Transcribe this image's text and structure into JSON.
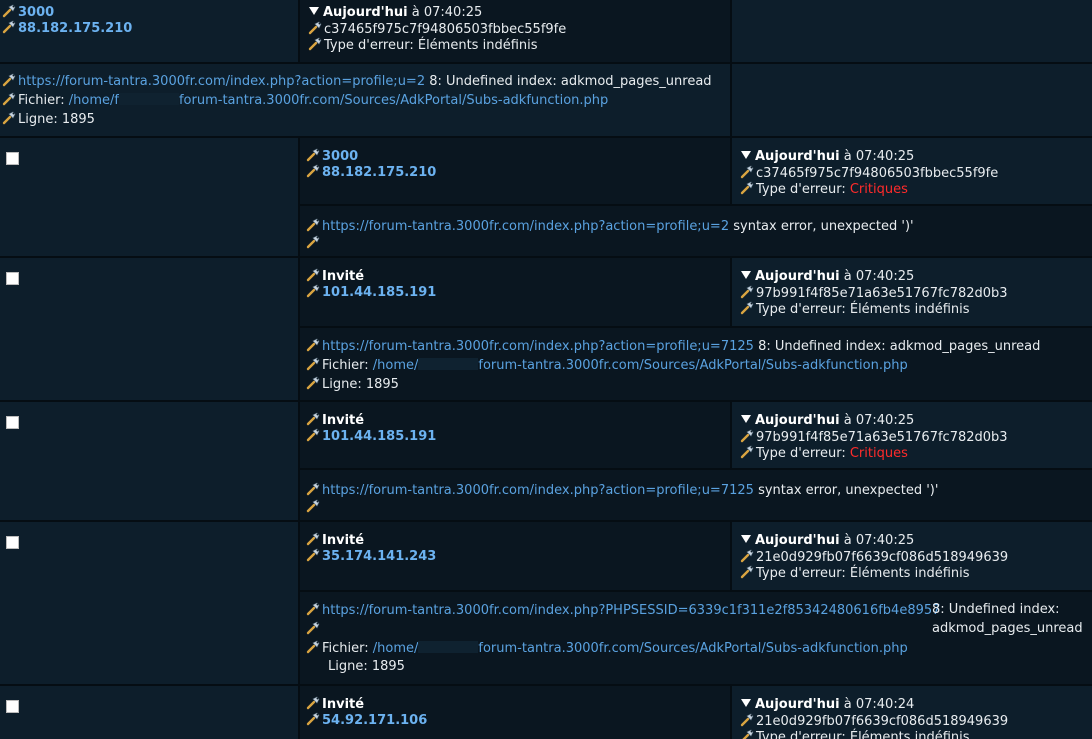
{
  "colors": {
    "link": "#5aa2e0",
    "critical": "#ff2b2b",
    "background": "#0b1a25"
  },
  "icons": {
    "wrench": "wrench-icon",
    "triangle": "triangle-down-icon"
  },
  "top_block": {
    "user": "3000",
    "ip": "88.182.175.210",
    "when_bold": "Aujourd'hui",
    "when_rest": " à 07:40:25",
    "hash": "c37465f975c7f94806503fbbec55f9fe",
    "type_label": "Type d'erreur: ",
    "type_value": "Éléments indéfinis",
    "url": "https://forum-tantra.3000fr.com/index.php?action=profile;u=2",
    "message": "8: Undefined index: adkmod_pages_unread",
    "file_label": "Fichier: ",
    "file_prefix": "/home/f",
    "file_suffix": "forum-tantra.3000fr.com/Sources/AdkPortal/Subs-adkfunction.php",
    "line": "Ligne: 1895"
  },
  "entries": [
    {
      "user": "3000",
      "ip": "88.182.175.210",
      "when_bold": "Aujourd'hui",
      "when_rest": " à 07:40:25",
      "hash": "c37465f975c7f94806503fbbec55f9fe",
      "type_label": "Type d'erreur: ",
      "type_value": "Critiques",
      "url": "https://forum-tantra.3000fr.com/index.php?action=profile;u=2",
      "message": "syntax error, unexpected ')'"
    },
    {
      "user": "Invité",
      "ip": "101.44.185.191",
      "when_bold": "Aujourd'hui",
      "when_rest": " à 07:40:25",
      "hash": "97b991f4f85e71a63e51767fc782d0b3",
      "type_label": "Type d'erreur: ",
      "type_value": "Éléments indéfinis",
      "url": "https://forum-tantra.3000fr.com/index.php?action=profile;u=7125",
      "message": "8: Undefined index: adkmod_pages_unread",
      "file_label": "Fichier: ",
      "file_prefix": "/home/",
      "file_suffix": "forum-tantra.3000fr.com/Sources/AdkPortal/Subs-adkfunction.php",
      "line": "Ligne: 1895"
    },
    {
      "user": "Invité",
      "ip": "101.44.185.191",
      "when_bold": "Aujourd'hui",
      "when_rest": " à 07:40:25",
      "hash": "97b991f4f85e71a63e51767fc782d0b3",
      "type_label": "Type d'erreur: ",
      "type_value": "Critiques",
      "url": "https://forum-tantra.3000fr.com/index.php?action=profile;u=7125",
      "message": "syntax error, unexpected ')'"
    },
    {
      "user": "Invité",
      "ip": "35.174.141.243",
      "when_bold": "Aujourd'hui",
      "when_rest": " à 07:40:25",
      "hash": "21e0d929fb07f6639cf086d518949639",
      "type_label": "Type d'erreur: ",
      "type_value": "Éléments indéfinis",
      "url": "https://forum-tantra.3000fr.com/index.php?PHPSESSID=6339c1f311e2f85342480616fb4e8957",
      "message_l1": "8: Undefined index:",
      "message_l2": "adkmod_pages_unread",
      "file_label": "Fichier: ",
      "file_prefix": "/home/",
      "file_suffix": "forum-tantra.3000fr.com/Sources/AdkPortal/Subs-adkfunction.php",
      "line": "Ligne: 1895"
    },
    {
      "user": "Invité",
      "ip": "54.92.171.106",
      "when_bold": "Aujourd'hui",
      "when_rest": " à 07:40:24",
      "hash": "21e0d929fb07f6639cf086d518949639",
      "type_label": "Type d'erreur: ",
      "type_value": "Éléments indéfinis"
    }
  ]
}
